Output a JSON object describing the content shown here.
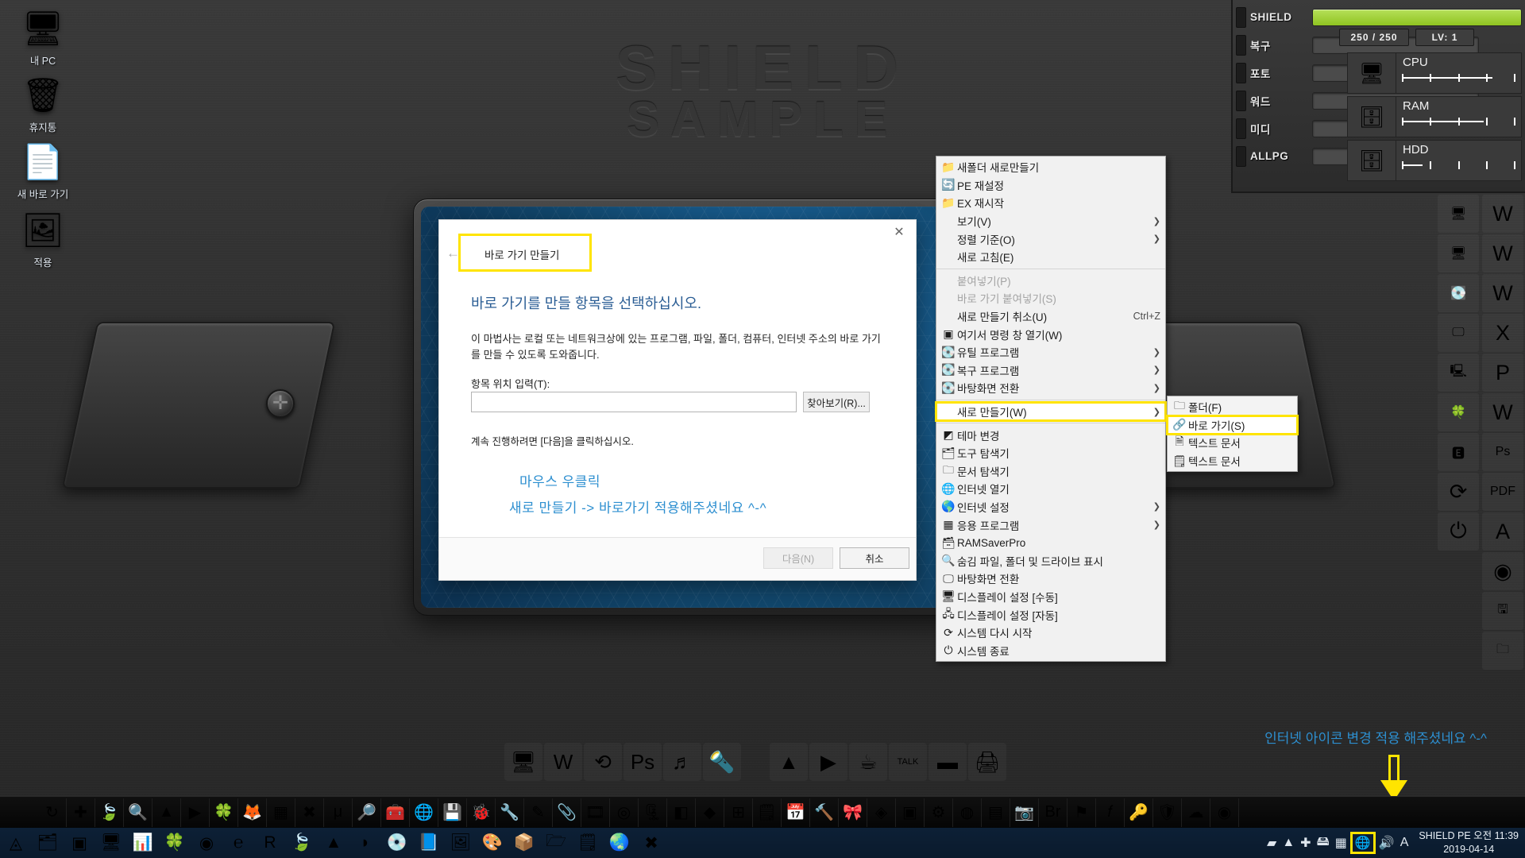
{
  "wallpaper": {
    "brand_line1": "SHIELD",
    "brand_line2": "SAMPLE"
  },
  "desktop_icons": [
    {
      "label": "내 PC",
      "icon": "computer-icon",
      "glyph": "🖥"
    },
    {
      "label": "휴지통",
      "icon": "recycle-bin-icon",
      "glyph": "🗑"
    },
    {
      "label": "새 바로 가기",
      "icon": "blank-document-icon",
      "glyph": "📄"
    },
    {
      "label": "적용",
      "icon": "apply-shortcut-icon",
      "glyph": "🖼"
    }
  ],
  "gadget": {
    "bars": [
      {
        "label": "SHIELD",
        "fill": 100,
        "primary": true
      },
      {
        "label": "복구",
        "fill": 0
      },
      {
        "label": "포토",
        "fill": 0
      },
      {
        "label": "워드",
        "fill": 0
      },
      {
        "label": "미디",
        "fill": 0
      },
      {
        "label": "ALLPG",
        "fill": 0
      }
    ],
    "hp": "250 / 250",
    "level": "LV: 1",
    "meters": [
      {
        "label": "CPU",
        "icon": "monitor-icon",
        "glyph": "🖥",
        "value": 80
      },
      {
        "label": "RAM",
        "icon": "ram-module-icon",
        "glyph": "🗄",
        "value": 72
      },
      {
        "label": "HDD",
        "icon": "hard-disk-icon",
        "glyph": "🗄",
        "value": 18
      }
    ],
    "accent_green": "#9ed13a"
  },
  "context_menu": {
    "items": [
      {
        "label": "새폴더 새로만들기",
        "icon": "new-folder-icon",
        "glyph": "📁",
        "type": "item"
      },
      {
        "label": "PE 재설정",
        "icon": "refresh-icon",
        "glyph": "🔄",
        "type": "item"
      },
      {
        "label": "EX 재시작",
        "icon": "folder-icon",
        "glyph": "📁",
        "type": "item"
      },
      {
        "label": "보기(V)",
        "icon": "",
        "glyph": "",
        "type": "submenu"
      },
      {
        "label": "정렬 기준(O)",
        "icon": "",
        "glyph": "",
        "type": "submenu"
      },
      {
        "label": "새로 고침(E)",
        "icon": "",
        "glyph": "",
        "type": "item"
      },
      {
        "type": "separator"
      },
      {
        "label": "붙여넣기(P)",
        "icon": "",
        "glyph": "",
        "type": "disabled"
      },
      {
        "label": "바로 가기 붙여넣기(S)",
        "icon": "",
        "glyph": "",
        "type": "disabled"
      },
      {
        "label": "새로 만들기 취소(U)",
        "accel": "Ctrl+Z",
        "icon": "",
        "glyph": "",
        "type": "item"
      },
      {
        "label": "여기서 명령 창 열기(W)",
        "icon": "command-prompt-icon",
        "glyph": "▣",
        "type": "item"
      },
      {
        "label": "유틸 프로그램",
        "icon": "disk-tools-icon",
        "glyph": "💽",
        "type": "submenu"
      },
      {
        "label": "복구 프로그램",
        "icon": "disk-tools-icon",
        "glyph": "💽",
        "type": "submenu"
      },
      {
        "label": "바탕화면 전환",
        "icon": "disk-tools-icon",
        "glyph": "💽",
        "type": "submenu"
      },
      {
        "type": "separator"
      },
      {
        "label": "새로 만들기(W)",
        "icon": "",
        "glyph": "",
        "type": "submenu",
        "highlight": true
      },
      {
        "type": "separator"
      },
      {
        "label": "테마 변경",
        "icon": "theme-icon",
        "glyph": "◩",
        "type": "item"
      },
      {
        "label": "도구 탐색기",
        "icon": "tools-explorer-icon",
        "glyph": "🗂",
        "type": "item"
      },
      {
        "label": "문서 탐색기",
        "icon": "documents-explorer-icon",
        "glyph": "🗀",
        "type": "item"
      },
      {
        "label": "인터넷 열기",
        "icon": "internet-explorer-icon",
        "glyph": "🌐",
        "type": "item"
      },
      {
        "label": "인터넷 설정",
        "icon": "internet-settings-icon",
        "glyph": "🌎",
        "type": "submenu"
      },
      {
        "label": "응용 프로그램",
        "icon": "applications-icon",
        "glyph": "▦",
        "type": "submenu"
      },
      {
        "label": "RAMSaverPro",
        "icon": "ramsaver-icon",
        "glyph": "🗃",
        "type": "item"
      },
      {
        "label": "숨김 파일, 폴더 및 드라이브 표시",
        "icon": "show-hidden-icon",
        "glyph": "🔍",
        "type": "item"
      },
      {
        "label": "바탕화면 전환",
        "icon": "switch-desktop-icon",
        "glyph": "🖵",
        "type": "item"
      },
      {
        "label": "디스플레이 설정 [수동]",
        "icon": "display-manual-icon",
        "glyph": "🖥",
        "type": "item"
      },
      {
        "label": "디스플레이 설정 [자동]",
        "icon": "display-auto-icon",
        "glyph": "🖧",
        "type": "item"
      },
      {
        "label": "시스템 다시 시작",
        "icon": "restart-icon",
        "glyph": "⟳",
        "type": "item"
      },
      {
        "label": "시스템 종료",
        "icon": "shutdown-icon",
        "glyph": "⏻",
        "type": "item"
      }
    ],
    "submenu": {
      "items": [
        {
          "label": "폴더(F)",
          "icon": "folder-icon",
          "glyph": "🗀"
        },
        {
          "label": "바로 가기(S)",
          "icon": "shortcut-icon",
          "glyph": "🔗",
          "highlight": true
        },
        {
          "label": "텍스트 문서",
          "icon": "text-document-icon",
          "glyph": "🗎"
        },
        {
          "label": "텍스트 문서",
          "icon": "notepad-document-icon",
          "glyph": "🗒"
        }
      ]
    }
  },
  "dialog": {
    "title": "바로 가기 만들기",
    "heading": "바로 가기를 만들 항목을 선택하십시오.",
    "description": "이 마법사는 로컬 또는 네트워크상에 있는 프로그램, 파일, 폴더, 컴퓨터, 인터넷 주소의 바로 가기를 만들 수 있도록 도와줍니다.",
    "field_label": "항목 위치 입력(T):",
    "field_value": "",
    "field_placeholder": "",
    "browse_button": "찾아보기(R)...",
    "hint": "계속 진행하려면 [다음]을 클릭하십시오.",
    "note_line1": "마우스 우클릭",
    "note_line2": "새로 만들기 -> 바로가기 적용해주셨네요 ^-^",
    "next_button": "다음(N)",
    "cancel_button": "취소",
    "close_glyph": "✕",
    "back_glyph": "←",
    "highlight_color": "#ffe400",
    "note_color": "#2d8fd0"
  },
  "right_dock": {
    "column_a": [
      {
        "icon": "monitor-tool-icon",
        "glyph": "🖥"
      },
      {
        "icon": "dual-monitor-icon",
        "glyph": "🖥"
      },
      {
        "icon": "magenta-disk-icon",
        "glyph": "💽"
      },
      {
        "icon": "dark-screen-icon",
        "glyph": "🖵"
      },
      {
        "icon": "desktop-pc-icon",
        "glyph": "🖳"
      },
      {
        "icon": "clover-icon",
        "glyph": "🍀"
      },
      {
        "icon": "everything-search-icon",
        "glyph": "🅴"
      },
      {
        "icon": "refresh-green-icon",
        "glyph": "⟳"
      },
      {
        "icon": "power-icon",
        "glyph": "⏻"
      }
    ],
    "column_b": [
      {
        "icon": "word-icon",
        "glyph": "W"
      },
      {
        "icon": "word-icon",
        "glyph": "W"
      },
      {
        "icon": "word-icon",
        "glyph": "W"
      },
      {
        "icon": "excel-icon",
        "glyph": "X"
      },
      {
        "icon": "powerpoint-icon",
        "glyph": "P"
      },
      {
        "icon": "word-doc-icon",
        "glyph": "W"
      },
      {
        "icon": "photoshop-icon",
        "glyph": "Ps"
      },
      {
        "icon": "pdf-icon",
        "glyph": "PDF"
      },
      {
        "icon": "acrobat-icon",
        "glyph": "A"
      },
      {
        "icon": "chrome-icon",
        "glyph": "◉"
      },
      {
        "icon": "floppy-icon",
        "glyph": "🖫"
      },
      {
        "icon": "folder-icon",
        "glyph": "🗀"
      }
    ]
  },
  "center_dock": {
    "group_left": [
      {
        "icon": "remote-desktop-icon",
        "glyph": "🖥"
      },
      {
        "icon": "word-icon",
        "glyph": "W"
      },
      {
        "icon": "recovery-icon",
        "glyph": "⟲"
      },
      {
        "icon": "photoshop-icon",
        "glyph": "Ps"
      },
      {
        "icon": "music-player-icon",
        "glyph": "♬"
      },
      {
        "icon": "projector-icon",
        "glyph": "🔦"
      }
    ],
    "group_right": [
      {
        "icon": "altools-icon",
        "glyph": "▲"
      },
      {
        "icon": "media-play-icon",
        "glyph": "▶"
      },
      {
        "icon": "coffee-icon",
        "glyph": "☕"
      },
      {
        "icon": "kakaotalk-icon",
        "glyph": "TALK"
      },
      {
        "icon": "blue-device-icon",
        "glyph": "▬"
      },
      {
        "icon": "scanner-icon",
        "glyph": "🖨"
      }
    ]
  },
  "taskbar_upper": {
    "items": [
      {
        "icon": "teamviewer-icon",
        "glyph": "↻"
      },
      {
        "icon": "plus-icon",
        "glyph": "✚"
      },
      {
        "icon": "alzip-icon",
        "glyph": "🍃"
      },
      {
        "icon": "search-orange-icon",
        "glyph": "🔍"
      },
      {
        "icon": "altools-icon",
        "glyph": "▲"
      },
      {
        "icon": "live-play-icon",
        "glyph": "▶"
      },
      {
        "icon": "clover-icon",
        "glyph": "🍀"
      },
      {
        "icon": "firefox-alt-icon",
        "glyph": "🦊"
      },
      {
        "icon": "red-grid-icon",
        "glyph": "▦"
      },
      {
        "icon": "xmedia-icon",
        "glyph": "✖"
      },
      {
        "icon": "utorrent-icon",
        "glyph": "μ"
      },
      {
        "icon": "image-viewer-icon",
        "glyph": "🔎"
      },
      {
        "icon": "red-tools-icon",
        "glyph": "🧰"
      },
      {
        "icon": "globe-disk-icon",
        "glyph": "🌐"
      },
      {
        "icon": "hdd-icon",
        "glyph": "💾"
      },
      {
        "icon": "ladybug-icon",
        "glyph": "🐞"
      },
      {
        "icon": "tools-icon",
        "glyph": "🔧"
      },
      {
        "icon": "pencil-icon",
        "glyph": "✎"
      },
      {
        "icon": "clip-icon",
        "glyph": "📎"
      },
      {
        "icon": "media-icon",
        "glyph": "🎞"
      },
      {
        "icon": "nero-icon",
        "glyph": "◎"
      },
      {
        "icon": "archive-icon",
        "glyph": "🗜"
      },
      {
        "icon": "blue-app-icon",
        "glyph": "◧"
      },
      {
        "icon": "diamond-icon",
        "glyph": "◆"
      },
      {
        "icon": "windows-icon",
        "glyph": "⊞"
      },
      {
        "icon": "green-note-icon",
        "glyph": "🗒"
      },
      {
        "icon": "calendar-icon",
        "glyph": "📅"
      },
      {
        "icon": "resource-hacker-icon",
        "glyph": "🔨"
      },
      {
        "icon": "pink-tool-icon",
        "glyph": "🎀"
      },
      {
        "icon": "purple-app-icon",
        "glyph": "◈"
      },
      {
        "icon": "blue-square-icon",
        "glyph": "▣"
      },
      {
        "icon": "settings-icon",
        "glyph": "⚙"
      },
      {
        "icon": "sphere-icon",
        "glyph": "◍"
      },
      {
        "icon": "grid-icon",
        "glyph": "▤"
      },
      {
        "icon": "camera-icon",
        "glyph": "📷"
      },
      {
        "icon": "bridge-icon",
        "glyph": "Br"
      },
      {
        "icon": "flag-icon",
        "glyph": "⚑"
      },
      {
        "icon": "f-script-icon",
        "glyph": "𝑓"
      },
      {
        "icon": "key-icon",
        "glyph": "🔑"
      },
      {
        "icon": "shield-red-icon",
        "glyph": "🛡"
      },
      {
        "icon": "cloud-icon",
        "glyph": "☁"
      },
      {
        "icon": "blue-round-icon",
        "glyph": "◉"
      }
    ]
  },
  "taskbar_lower": {
    "start_glyph": "◬",
    "items": [
      {
        "icon": "file-explorer-icon",
        "glyph": "🗂"
      },
      {
        "icon": "command-prompt-icon",
        "glyph": "▣"
      },
      {
        "icon": "remote-screen-icon",
        "glyph": "🖥"
      },
      {
        "icon": "monitoring-icon",
        "glyph": "📊"
      },
      {
        "icon": "clover-icon",
        "glyph": "🍀"
      },
      {
        "icon": "chrome-icon",
        "glyph": "◉"
      },
      {
        "icon": "internet-explorer-icon",
        "glyph": "℮"
      },
      {
        "icon": "r-gold-icon",
        "glyph": "R"
      },
      {
        "icon": "alzip-icon",
        "glyph": "🍃"
      },
      {
        "icon": "altools-icon",
        "glyph": "▲"
      },
      {
        "icon": "red-white-icon",
        "glyph": "◗"
      },
      {
        "icon": "disc-icon",
        "glyph": "💿"
      },
      {
        "icon": "paper-icon",
        "glyph": "📘"
      },
      {
        "icon": "dark-photo-icon",
        "glyph": "🖼"
      },
      {
        "icon": "paint-icon",
        "glyph": "🎨"
      },
      {
        "icon": "virtualbox-icon",
        "glyph": "📦"
      },
      {
        "icon": "folder-up-icon",
        "glyph": "🗁"
      },
      {
        "icon": "list-up-icon",
        "glyph": "🗒"
      },
      {
        "icon": "globe-sync-icon",
        "glyph": "🌏"
      },
      {
        "icon": "close-red-x-icon",
        "glyph": "✖"
      }
    ],
    "tray": [
      {
        "icon": "nvidia-icon",
        "glyph": "▰"
      },
      {
        "icon": "altools-red-icon",
        "glyph": "▲"
      },
      {
        "icon": "plus-grey-icon",
        "glyph": "✚"
      },
      {
        "icon": "usb-eject-icon",
        "glyph": "🖴"
      },
      {
        "icon": "color-swatch-icon",
        "glyph": "▦"
      },
      {
        "icon": "network-globe-icon",
        "glyph": "🌐",
        "highlight": true
      },
      {
        "icon": "volume-icon",
        "glyph": "🔊"
      },
      {
        "icon": "input-language-icon",
        "glyph": "A"
      }
    ],
    "clock_line1": "SHIELD PE 오전 11:39",
    "clock_line2": "2019-04-14"
  },
  "annotations": {
    "tray_note": "인터넷 아이콘 변경 적용 해주셨네요 ^-^",
    "arrow_color": "#ffe400"
  }
}
